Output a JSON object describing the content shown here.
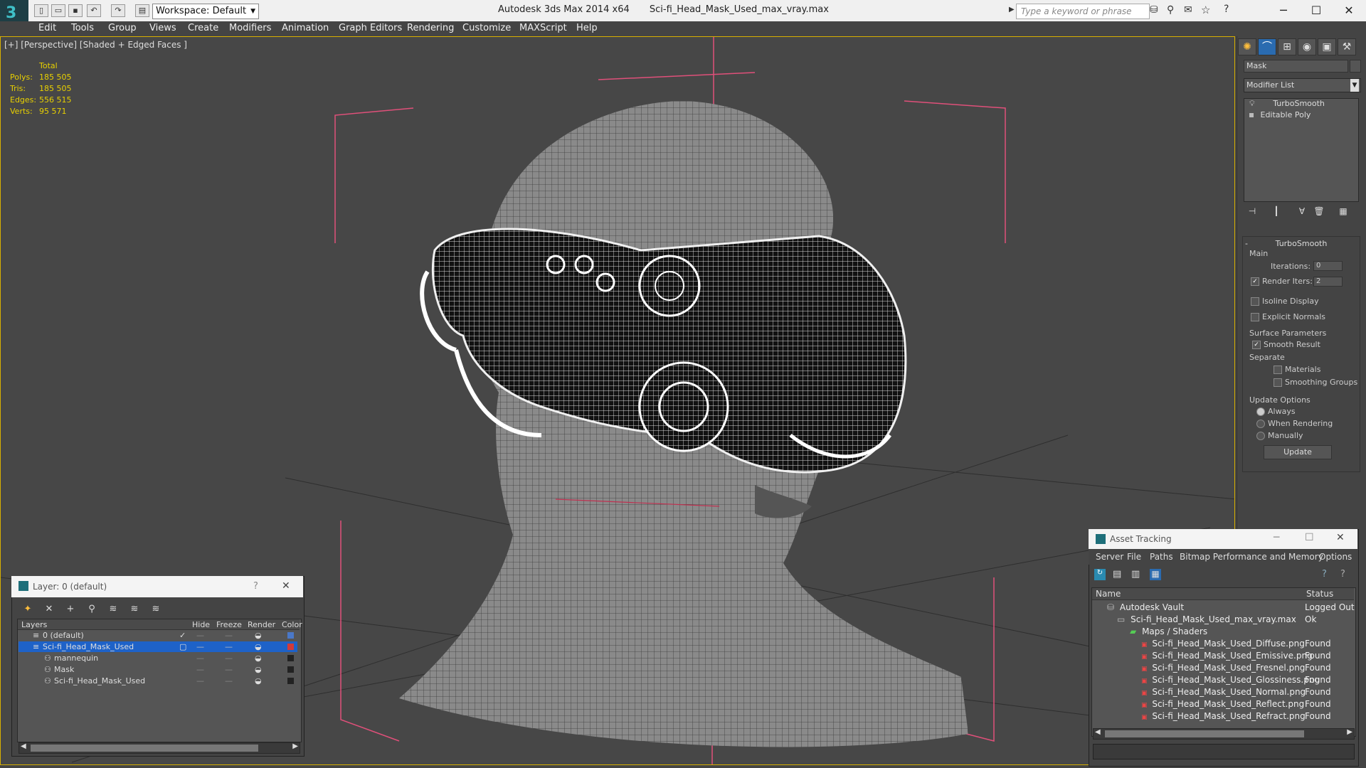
{
  "titlebar": {
    "workspace": "Workspace: Default",
    "app_title": "Autodesk 3ds Max  2014 x64",
    "file_title": "Sci-fi_Head_Mask_Used_max_vray.max",
    "search_placeholder": "Type a keyword or phrase"
  },
  "menu": [
    "Edit",
    "Tools",
    "Group",
    "Views",
    "Create",
    "Modifiers",
    "Animation",
    "Graph Editors",
    "Rendering",
    "Customize",
    "MAXScript",
    "Help"
  ],
  "viewport": {
    "label": "[+] [Perspective] [Shaded + Edged Faces ]",
    "stats": {
      "header": "Total",
      "polys_label": "Polys:",
      "polys": "185 505",
      "tris_label": "Tris:",
      "tris": "185 505",
      "edges_label": "Edges:",
      "edges": "556 515",
      "verts_label": "Verts:",
      "verts": "95 571"
    }
  },
  "command_panel": {
    "object_name": "Mask",
    "modifier_list": "Modifier List",
    "stack": [
      "TurboSmooth",
      "Editable Poly"
    ],
    "rollout_title": "TurboSmooth",
    "main_label": "Main",
    "iterations_label": "Iterations:",
    "iterations": "0",
    "render_iters_label": "Render Iters:",
    "render_iters": "2",
    "isoline": "Isoline Display",
    "explicit_normals": "Explicit Normals",
    "surface_params": "Surface Parameters",
    "smooth_result": "Smooth Result",
    "separate": "Separate",
    "materials": "Materials",
    "smoothing_groups": "Smoothing Groups",
    "update_options": "Update Options",
    "always": "Always",
    "when_rendering": "When Rendering",
    "manually": "Manually",
    "update_button": "Update"
  },
  "layer_dialog": {
    "title": "Layer: 0 (default)",
    "help": "?",
    "columns": [
      "Layers",
      "Hide",
      "Freeze",
      "Render",
      "Color"
    ],
    "rows": [
      {
        "name": "0 (default)",
        "color": "#4a78c8"
      },
      {
        "name": "Sci-fi_Head_Mask_Used",
        "color": "#d23a3a"
      },
      {
        "name": "mannequin",
        "color": "#222222"
      },
      {
        "name": "Mask",
        "color": "#222222"
      },
      {
        "name": "Sci-fi_Head_Mask_Used",
        "color": "#222222"
      }
    ]
  },
  "asset_dialog": {
    "title": "Asset Tracking",
    "menu": [
      "Server",
      "File",
      "Paths",
      "Bitmap Performance and Memory",
      "Options"
    ],
    "col_name": "Name",
    "col_status": "Status",
    "rows": [
      {
        "name": "Autodesk Vault",
        "status": "Logged Out"
      },
      {
        "name": "Sci-fi_Head_Mask_Used_max_vray.max",
        "status": "Ok"
      },
      {
        "name": "Maps / Shaders",
        "status": ""
      },
      {
        "name": "Sci-fi_Head_Mask_Used_Diffuse.png",
        "status": "Found"
      },
      {
        "name": "Sci-fi_Head_Mask_Used_Emissive.png",
        "status": "Found"
      },
      {
        "name": "Sci-fi_Head_Mask_Used_Fresnel.png",
        "status": "Found"
      },
      {
        "name": "Sci-fi_Head_Mask_Used_Glossiness.png",
        "status": "Found"
      },
      {
        "name": "Sci-fi_Head_Mask_Used_Normal.png",
        "status": "Found"
      },
      {
        "name": "Sci-fi_Head_Mask_Used_Reflect.png",
        "status": "Found"
      },
      {
        "name": "Sci-fi_Head_Mask_Used_Refract.png",
        "status": "Found"
      }
    ]
  },
  "colors": {
    "accent_yellow": "#e8d000",
    "selection_blue": "#1e62c8",
    "gizmo_pink": "#e0507a"
  }
}
